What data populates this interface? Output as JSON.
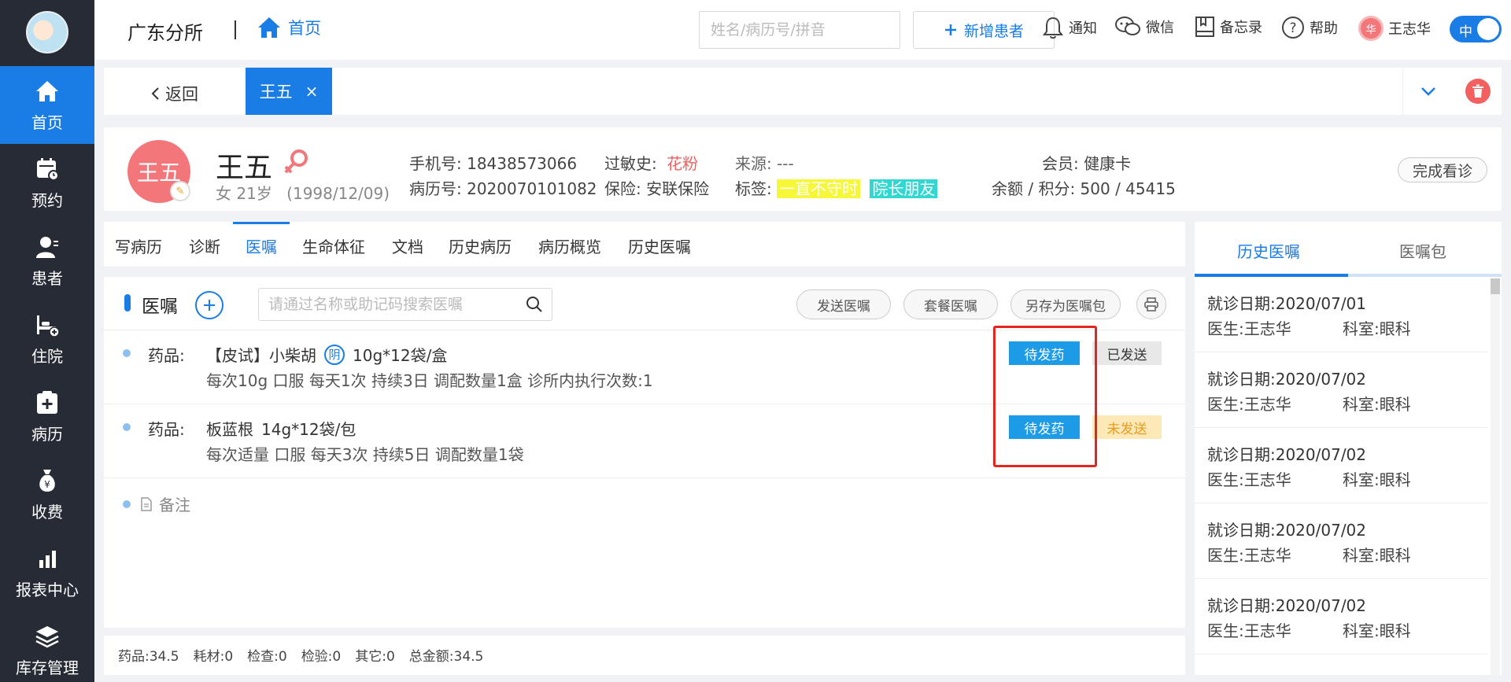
{
  "sidebar": {
    "items": [
      {
        "label": "首页",
        "icon": "home-icon"
      },
      {
        "label": "预约",
        "icon": "calendar-icon"
      },
      {
        "label": "患者",
        "icon": "patient-icon"
      },
      {
        "label": "住院",
        "icon": "bed-icon"
      },
      {
        "label": "病历",
        "icon": "medical-record-icon"
      },
      {
        "label": "收费",
        "icon": "money-bag-icon"
      },
      {
        "label": "报表中心",
        "icon": "bar-chart-icon"
      },
      {
        "label": "库存管理",
        "icon": "layers-icon"
      }
    ]
  },
  "header": {
    "clinic": "广东分所",
    "breadcrumb_home": "首页",
    "search_placeholder": "姓名/病历号/拼音",
    "add_patient": "新增患者",
    "notify": "通知",
    "wechat": "微信",
    "memo": "备忘录",
    "help": "帮助",
    "user_initial": "华",
    "user_name": "王志华",
    "lang": "中"
  },
  "tabbar": {
    "back": "返回",
    "patient_tab": "王五",
    "close": "×"
  },
  "patient": {
    "avatar_text": "王五",
    "name": "王五",
    "gender_age": "女  21岁",
    "birthday": "(1998/12/09)",
    "phone": "手机号: 18438573066",
    "record_no": "病历号: 2020070101082",
    "allergy_label": "过敏史:",
    "allergy_value": "花粉",
    "insurance": "保险: 安联保险",
    "source": "来源: ---",
    "tags_label": "标签:",
    "tag1": "一直不守时",
    "tag2": "院长朋友",
    "member": "会员: 健康卡",
    "balance": "余额 / 积分: 500 / 45415",
    "finish": "完成看诊"
  },
  "subtabs": [
    "写病历",
    "诊断",
    "医嘱",
    "生命体征",
    "文档",
    "历史病历",
    "病历概览",
    "历史医嘱"
  ],
  "orders_panel": {
    "title": "医嘱",
    "search_placeholder": "请通过名称或助记码搜索医嘱",
    "send": "发送医嘱",
    "package": "套餐医嘱",
    "save_as": "另存为医嘱包"
  },
  "orders": [
    {
      "kind": "药品:",
      "name": "【皮试】小柴胡",
      "badge": "阴",
      "spec": "10g*12袋/盒",
      "detail": "每次10g   口服   每天1次   持续3日   调配数量1盒   诊所内执行次数:1",
      "action": "待发药",
      "status": "已发送",
      "status_type": "sent"
    },
    {
      "kind": "药品:",
      "name": "板蓝根",
      "badge": "",
      "spec": "14g*12袋/包",
      "detail": "每次适量   口服   每天3次   持续5日   调配数量1袋",
      "action": "待发药",
      "status": "未发送",
      "status_type": "unsent"
    }
  ],
  "note": "备注",
  "totals": {
    "drug": "药品:34.5",
    "material": "耗材:0",
    "exam": "检查:0",
    "test": "检验:0",
    "other": "其它:0",
    "total": "总金额:34.5"
  },
  "right_panel": {
    "tab1": "历史医嘱",
    "tab2": "医嘱包",
    "items": [
      {
        "date": "就诊日期:2020/07/01",
        "doctor": "医生:王志华",
        "dept": "科室:眼科"
      },
      {
        "date": "就诊日期:2020/07/02",
        "doctor": "医生:王志华",
        "dept": "科室:眼科"
      },
      {
        "date": "就诊日期:2020/07/02",
        "doctor": "医生:王志华",
        "dept": "科室:眼科"
      },
      {
        "date": "就诊日期:2020/07/02",
        "doctor": "医生:王志华",
        "dept": "科室:眼科"
      },
      {
        "date": "就诊日期:2020/07/02",
        "doctor": "医生:王志华",
        "dept": "科室:眼科"
      }
    ]
  },
  "colors": {
    "primary": "#1a7de6",
    "sidebar": "#262b35",
    "highlight": "#e3241f"
  }
}
